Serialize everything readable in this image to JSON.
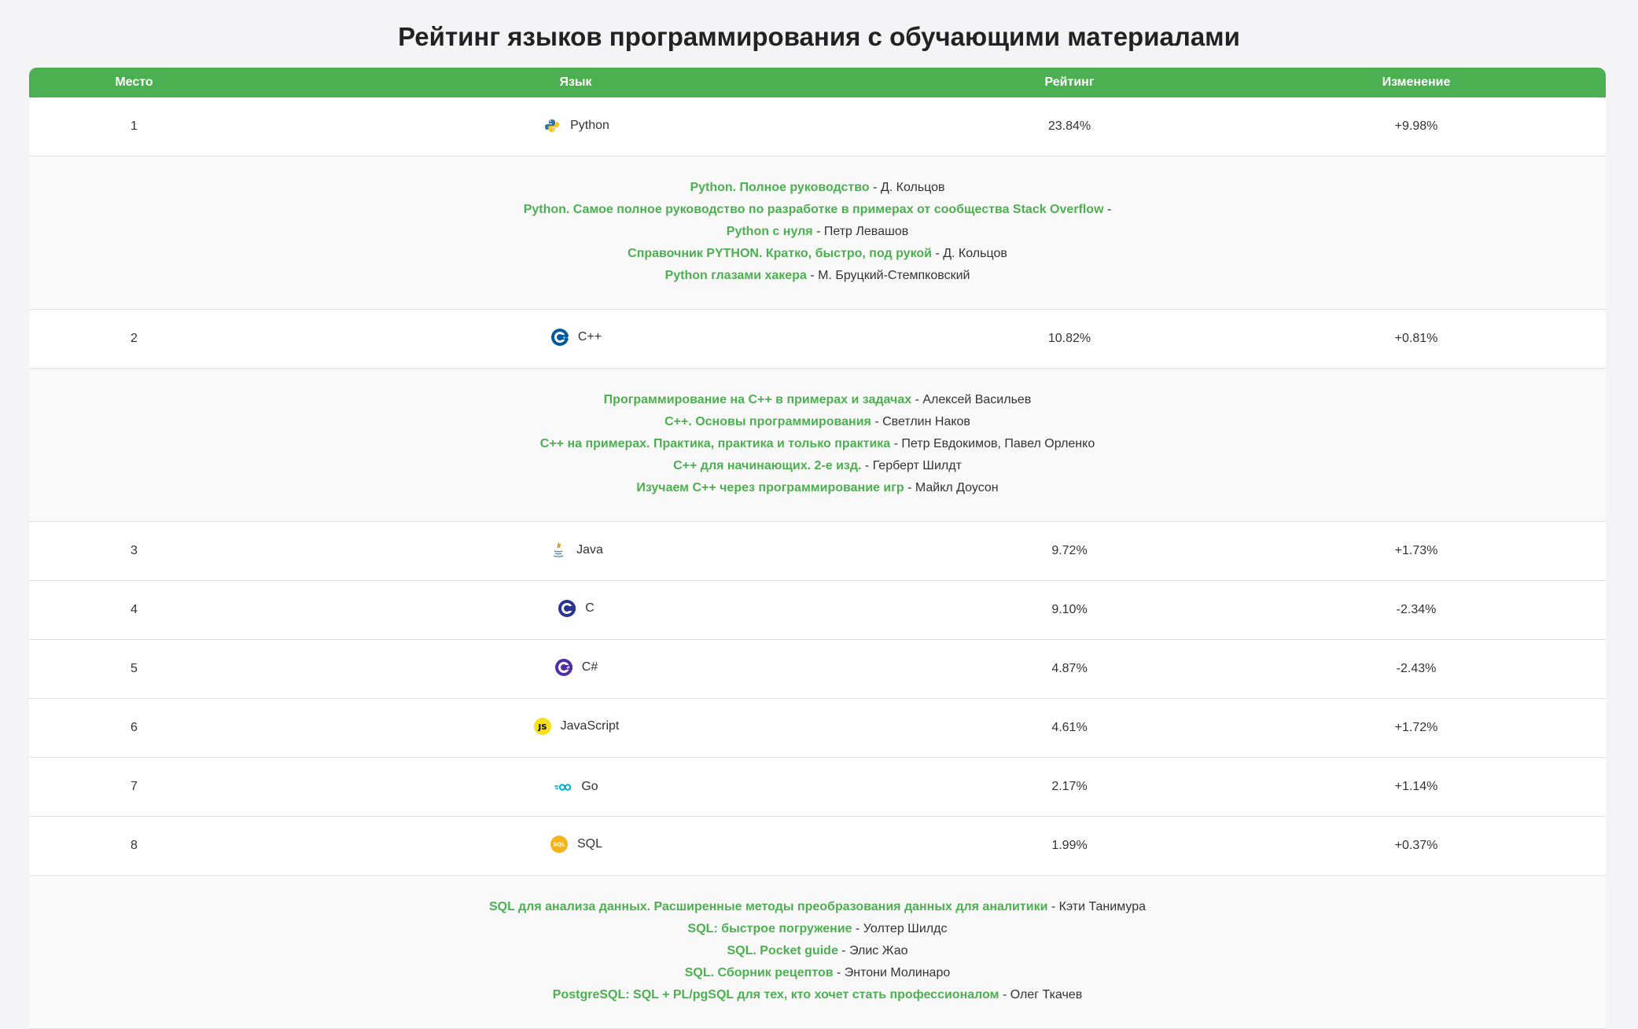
{
  "page": {
    "title": "Рейтинг языков программирования с обучающими материалами"
  },
  "columns": {
    "place": "Место",
    "language": "Язык",
    "rating": "Рейтинг",
    "change": "Изменение"
  },
  "rows": [
    {
      "place": "1",
      "name": "Python",
      "icon": "python-icon",
      "rating": "23.84%",
      "change": "+9.98%"
    },
    {
      "place": "2",
      "name": "C++",
      "icon": "cpp-icon",
      "rating": "10.82%",
      "change": "+0.81%"
    },
    {
      "place": "3",
      "name": "Java",
      "icon": "java-icon",
      "rating": "9.72%",
      "change": "+1.73%"
    },
    {
      "place": "4",
      "name": "C",
      "icon": "c-icon",
      "rating": "9.10%",
      "change": "-2.34%"
    },
    {
      "place": "5",
      "name": "C#",
      "icon": "csharp-icon",
      "rating": "4.87%",
      "change": "-2.43%"
    },
    {
      "place": "6",
      "name": "JavaScript",
      "icon": "javascript-icon",
      "rating": "4.61%",
      "change": "+1.72%"
    },
    {
      "place": "7",
      "name": "Go",
      "icon": "go-icon",
      "rating": "2.17%",
      "change": "+1.14%"
    },
    {
      "place": "8",
      "name": "SQL",
      "icon": "sql-icon",
      "rating": "1.99%",
      "change": "+0.37%"
    }
  ],
  "books": {
    "python": [
      {
        "title": "Python. Полное руководство",
        "sep": " - ",
        "author": "Д. Кольцов"
      },
      {
        "title": "Python. Самое полное руководство по разработке в примерах от сообщества Stack Overflow",
        "sep": " -",
        "author": ""
      },
      {
        "title": "Python с нуля",
        "sep": " - ",
        "author": "Петр Левашов"
      },
      {
        "title": "Справочник PYTHON. Кратко, быстро, под рукой",
        "sep": " - ",
        "author": "Д. Кольцов"
      },
      {
        "title": "Python глазами хакера",
        "sep": " - ",
        "author": "М. Бруцкий-Стемпковский"
      }
    ],
    "cpp": [
      {
        "title": "Программирование на C++ в примерах и задачах",
        "sep": " - ",
        "author": "Алексей Васильев"
      },
      {
        "title": "C++. Основы программирования",
        "sep": " - ",
        "author": "Светлин Наков"
      },
      {
        "title": "C++ на примерах. Практика, практика и только практика",
        "sep": " - ",
        "author": "Петр Евдокимов, Павел Орленко"
      },
      {
        "title": "C++ для начинающих. 2-е изд.",
        "sep": " - ",
        "author": "Герберт Шилдт"
      },
      {
        "title": "Изучаем C++ через программирование игр",
        "sep": " - ",
        "author": "Майкл Доусон"
      }
    ],
    "sql": [
      {
        "title": "SQL для анализа данных. Расширенные методы преобразования данных для аналитики",
        "sep": " - ",
        "author": "Кэти Танимура"
      },
      {
        "title": "SQL: быстрое погружение",
        "sep": " - ",
        "author": "Уолтер Шилдс"
      },
      {
        "title": "SQL. Pocket guide",
        "sep": " - ",
        "author": "Элис Жао"
      },
      {
        "title": "SQL. Сборник рецептов",
        "sep": " - ",
        "author": "Энтони Молинаро"
      },
      {
        "title": "PostgreSQL: SQL + PL/pgSQL для тех, кто хочет стать профессионалом",
        "sep": " - ",
        "author": "Олег Ткачев"
      }
    ]
  },
  "colors": {
    "accent": "#4caf50",
    "header_text": "#ffffff",
    "books_bg": "#f9f9f9"
  }
}
